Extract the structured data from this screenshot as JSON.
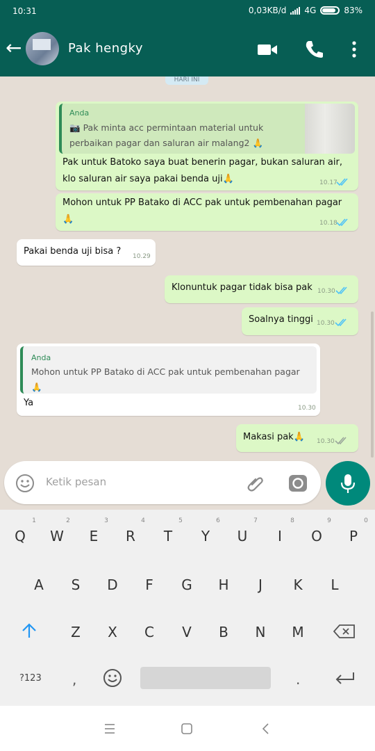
{
  "status": {
    "time": "10:31",
    "network": "0,03KB/d",
    "signal_type": "4G",
    "battery": "83%"
  },
  "header": {
    "contact_name": "Pak hengky"
  },
  "chat": {
    "date_chip": "HARI INI",
    "messages": [
      {
        "quote_author": "Anda",
        "quote_line1": "Pak minta acc permintaan material untuk",
        "quote_line2": "perbaikan pagar dan saluran air malang2 🙏",
        "line1": "Pak untuk Batoko saya buat benerin pagar, bukan saluran air,",
        "line2": "klo saluran air saya pakai benda uji🙏",
        "time": "10.17"
      },
      {
        "line1": "Mohon untuk PP Batako di ACC pak untuk pembenahan pagar",
        "line2": "🙏",
        "time": "10.18"
      },
      {
        "text": "Pakai benda uji bisa ?",
        "time": "10.29"
      },
      {
        "text": "Klonuntuk pagar tidak bisa pak",
        "time": "10.30"
      },
      {
        "text": "Soalnya tinggi",
        "time": "10.30"
      },
      {
        "quote_author": "Anda",
        "quote_line1": "Mohon untuk PP Batako di ACC pak untuk pembenahan pagar",
        "quote_line2": "🙏",
        "text": "Ya",
        "time": "10.30"
      },
      {
        "text": "Makasi pak🙏",
        "time": "10.30"
      }
    ]
  },
  "input": {
    "placeholder": "Ketik pesan"
  },
  "keyboard": {
    "numbers": [
      "1",
      "2",
      "3",
      "4",
      "5",
      "6",
      "7",
      "8",
      "9",
      "0"
    ],
    "row1": [
      "Q",
      "W",
      "E",
      "R",
      "T",
      "Y",
      "U",
      "I",
      "O",
      "P"
    ],
    "row2": [
      "A",
      "S",
      "D",
      "F",
      "G",
      "H",
      "J",
      "K",
      "L"
    ],
    "row3": [
      "Z",
      "X",
      "C",
      "V",
      "B",
      "N",
      "M"
    ],
    "symbols_key": "?123",
    "comma": ",",
    "period": "."
  },
  "colors": {
    "header": "#075e54",
    "outgoing_bubble": "#dcf8c6",
    "incoming_bubble": "#ffffff",
    "chat_bg": "#e5ddd5",
    "read_ticks": "#4fc3f7",
    "mic_button": "#00897b"
  }
}
